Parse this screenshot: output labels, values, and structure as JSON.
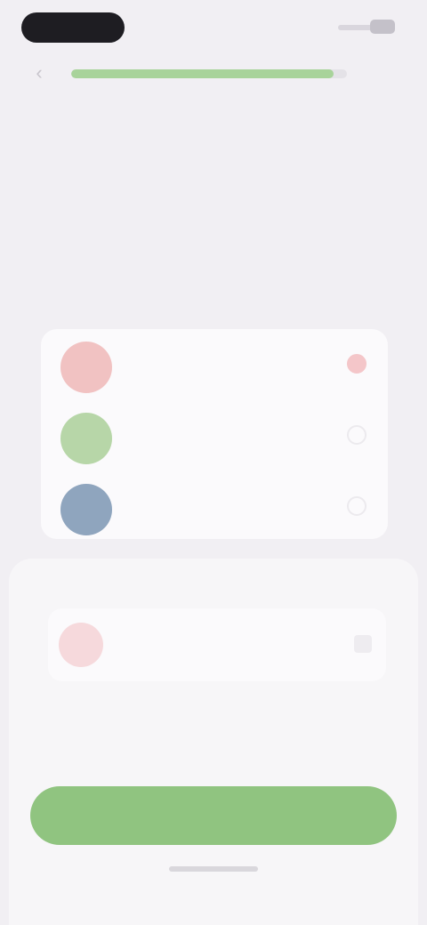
{
  "progress": {
    "fraction": 0.95
  },
  "header": {
    "heading_accent": "",
    "heading": "",
    "subtitle": ""
  },
  "pets": {
    "section_label": "",
    "items": [
      {
        "meta": "",
        "name": "",
        "color": "#f1c2c2",
        "selected": true
      },
      {
        "meta": "",
        "name": "",
        "color": "#b7d6a8",
        "selected": false
      },
      {
        "meta": "",
        "name": "",
        "color": "#8fa5be",
        "selected": false
      }
    ]
  },
  "sheet": {
    "reminder_title": "",
    "reminder_subtitle": "",
    "message": "",
    "cta_label": ""
  },
  "colors": {
    "accent": "#90c480",
    "background": "#f1eff3"
  }
}
